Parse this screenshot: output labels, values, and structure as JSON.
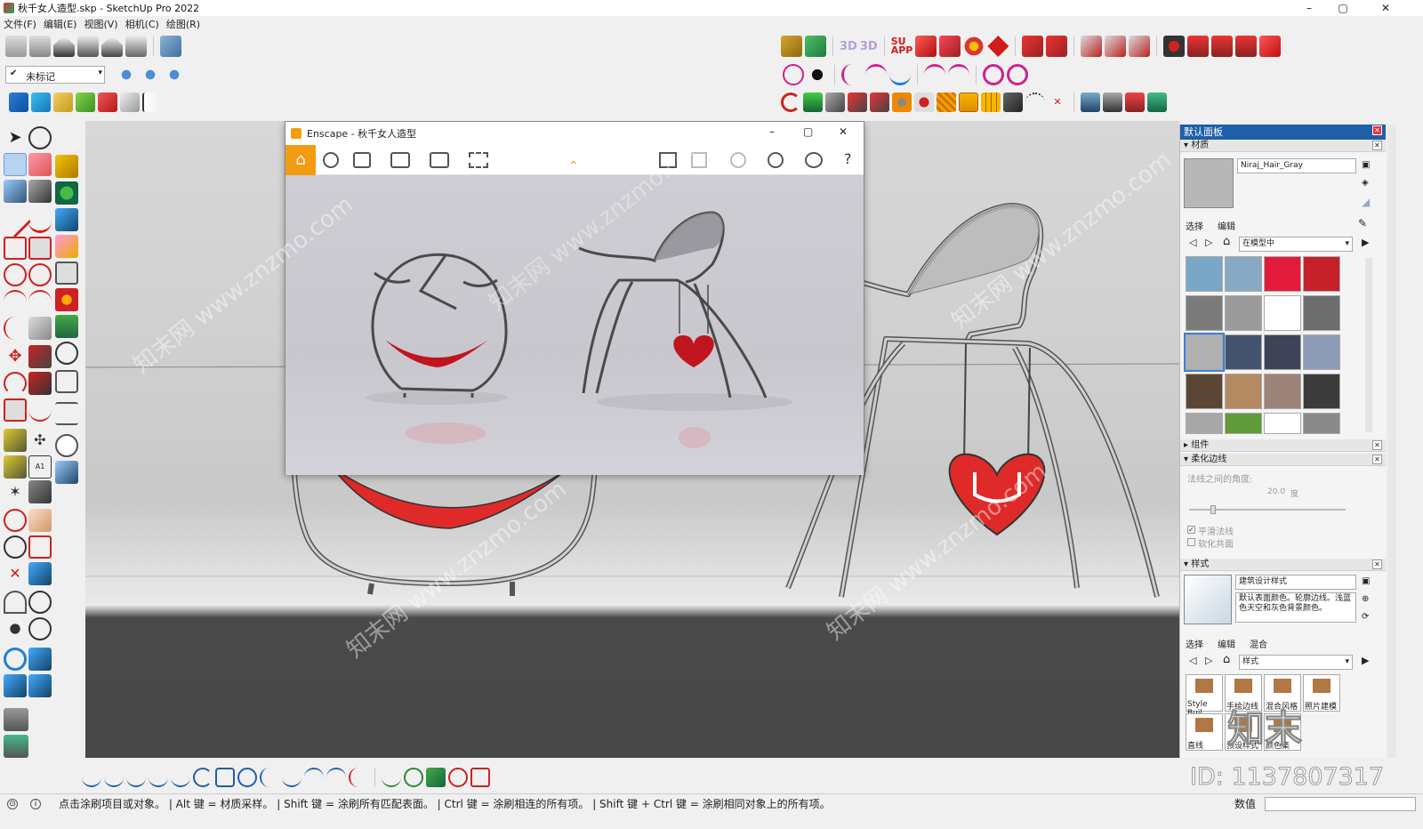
{
  "window": {
    "title": "秋千女人造型.skp - SketchUp Pro 2022",
    "minimize": "–",
    "maximize": "▢",
    "close": "✕"
  },
  "menu": [
    "文件(F)",
    "编辑(E)",
    "视图(V)",
    "相机(C)",
    "绘图(R)"
  ],
  "tag_dropdown": "未标记",
  "enscape": {
    "title": "Enscape - 秋千女人造型",
    "help": "?",
    "minimize": "–",
    "maximize": "▢",
    "close": "✕"
  },
  "panel": {
    "title": "默认面板",
    "materials": {
      "section": "材质",
      "name": "Niraj_Hair_Gray",
      "tab_select": "选择",
      "tab_edit": "编辑",
      "collection": "在模型中",
      "swatch_colors": [
        "#7aa7c7",
        "#87a9c4",
        "#e31b3b",
        "#c6202a",
        "#7b7b7b",
        "#9b9b9b",
        "#ffffff",
        "#6d6d6d",
        "#b0b0b0",
        "#44546f",
        "#3f4357",
        "#8f9cb8",
        "#5b4636",
        "#b48a60",
        "#9c8478",
        "#3b3b3b",
        "#a8a8a8",
        "#5f9b3b",
        "#ffffff",
        "#8a8a8a"
      ]
    },
    "components": {
      "section": "组件"
    },
    "soften": {
      "section": "柔化边线",
      "angle_label": "法线之间的角度:",
      "angle_value": "20.0",
      "angle_unit": "度",
      "smooth_normals": "平滑法线",
      "soften_coplanar": "软化共面"
    },
    "styles": {
      "section": "样式",
      "name": "建筑设计样式",
      "description": "默认表面颜色。轮廓边线。浅蓝色天空和灰色背景颜色。",
      "tab_select": "选择",
      "tab_edit": "编辑",
      "tab_mix": "混合",
      "collection": "样式",
      "thumbs": [
        "Style Buil",
        "手绘边线",
        "混合风格",
        "照片建模",
        "直线",
        "预设样式",
        "颜色集"
      ]
    }
  },
  "status": {
    "message": "点击涂刷项目或对象。 | Alt 键 = 材质采样。 | Shift 键 = 涂刷所有匹配表面。 | Ctrl 键 = 涂刷相连的所有项。 | Shift 键 + Ctrl 键 = 涂刷相同对象上的所有项。",
    "value_label": "数值"
  },
  "watermark": {
    "site": "知末网 www.znzmo.com",
    "id": "ID: 1137807317",
    "logo": "知末"
  }
}
